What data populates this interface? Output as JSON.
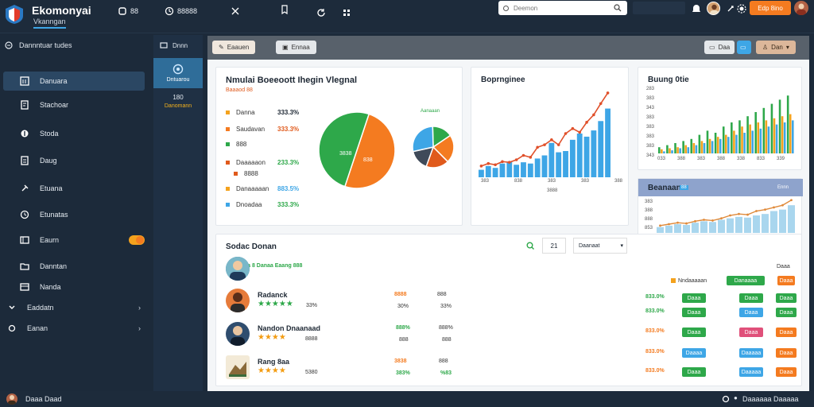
{
  "app": {
    "brand": "Ekomonyai",
    "brand_sub": "Vkanngan",
    "top_nav": [
      "88",
      "888",
      "88888"
    ],
    "search_placeholder": "Deemon",
    "cta_button": "Edp 8ino",
    "colors": {
      "accent": "#f47b20",
      "blue": "#3ea6e6",
      "green": "#2ea84a",
      "sidebar": "#1c2a3a"
    }
  },
  "sidebar": {
    "header": "Dannntuar tudes",
    "items": [
      {
        "label": "Danuara",
        "icon": "dashboard-icon",
        "active": true
      },
      {
        "label": "Stachoar",
        "icon": "document-icon"
      },
      {
        "label": "Stoda",
        "icon": "tag-icon"
      },
      {
        "label": "Daug",
        "icon": "file-icon"
      },
      {
        "label": "Etuana",
        "icon": "pin-icon"
      },
      {
        "label": "Etunatas",
        "icon": "clock-icon"
      },
      {
        "label": "Eaurn",
        "icon": "flag-icon",
        "toggle": true
      },
      {
        "label": "Danntan",
        "icon": "folder-icon"
      },
      {
        "label": "Nanda",
        "icon": "archive-icon"
      },
      {
        "label": "Eaddatn",
        "icon": "chevron-down-icon",
        "expandable": true
      },
      {
        "label": "Eanan",
        "icon": "gear-icon",
        "expandable": true
      }
    ]
  },
  "subcol": {
    "header": "Dnnn",
    "active_label": "Dntuarou",
    "count": "180",
    "count_sub": "Danomann"
  },
  "toolbar": {
    "btn1": "Eaauen",
    "btn2": "Ennaa",
    "right1": "Daa",
    "right2": "Dan"
  },
  "market_card": {
    "title": "Nmulai Boeeoott Ihegin Vlegnal",
    "subtitle": "Baaaod 88",
    "rows": [
      {
        "label": "Danna",
        "pct": "333.3%",
        "color": "#f4a21d",
        "pct_color": "#1d2733"
      },
      {
        "label": "Saudavan",
        "pct": "333.3%",
        "color": "#f47b20",
        "pct_color": "#e05a1c"
      },
      {
        "label": "888",
        "pct": "",
        "color": "#2ea84a",
        "pct_color": "#1d2733"
      },
      {
        "label": "Daaaaaon",
        "pct": "233.3%",
        "color": "#e05a1c",
        "pct_color": "#2ea84a"
      },
      {
        "label": "8888",
        "pct": "",
        "color": "#e05a1c",
        "pct_color": "#1d2733"
      },
      {
        "label": "Danaaaaan",
        "pct": "883.5%",
        "color": "#f4a21d",
        "pct_color": "#3ea6e6"
      },
      {
        "label": "Dnoadaa",
        "pct": "333.3%",
        "color": "#3ea6e6",
        "pct_color": "#2ea84a"
      }
    ],
    "pie_main_labels": [
      "3838",
      "838"
    ],
    "pie_small_label": "Aanaaan"
  },
  "chart_card1": {
    "title": "Boprnginee",
    "xticks": [
      "383",
      "838",
      "383",
      "383",
      "388"
    ],
    "xlabel": "3888"
  },
  "chart_card2": {
    "title": "Buung 0tie",
    "yticks": [
      "283",
      "383",
      "343",
      "383",
      "383",
      "383",
      "383",
      "343"
    ],
    "xticks": [
      "033",
      "388",
      "383",
      "388",
      "338",
      "833",
      "339"
    ]
  },
  "chart_card3": {
    "title": "Beanaans",
    "badge": "88",
    "right_label": "Ennn",
    "yticks": [
      "383",
      "388",
      "888",
      "853"
    ],
    "xticks": [
      "138",
      "388",
      "389",
      "383",
      "588",
      "383"
    ]
  },
  "chart_data": [
    {
      "type": "pie",
      "title": "",
      "labels": [
        "orange",
        "green"
      ],
      "values": [
        50,
        50
      ],
      "colors": [
        "#f47b20",
        "#2ea84a"
      ]
    },
    {
      "type": "pie",
      "title": "",
      "values": [
        16,
        22,
        18,
        16,
        28
      ],
      "colors": [
        "#2ea84a",
        "#f47b20",
        "#e05a1c",
        "#3f4a59",
        "#3ea6e6"
      ]
    },
    {
      "type": "bar+line",
      "title": "Boprnginee",
      "bars": [
        12,
        18,
        15,
        22,
        25,
        20,
        24,
        22,
        30,
        35,
        55,
        40,
        42,
        60,
        70,
        65,
        75,
        90,
        110
      ],
      "line": [
        18,
        22,
        20,
        25,
        24,
        28,
        35,
        32,
        48,
        52,
        60,
        52,
        70,
        78,
        72,
        88,
        100,
        118,
        135
      ]
    },
    {
      "type": "bar",
      "title": "Buung 0tie",
      "series": [
        {
          "values": [
            6,
            8,
            10,
            12,
            14,
            18,
            22,
            20,
            26,
            30,
            32,
            36,
            40,
            44,
            48,
            52,
            56
          ],
          "color": "#2ea84a"
        },
        {
          "values": [
            4,
            5,
            6,
            8,
            10,
            12,
            14,
            16,
            18,
            22,
            26,
            28,
            30,
            32,
            34,
            36,
            38
          ],
          "color": "#f4a21d"
        },
        {
          "values": [
            2,
            3,
            5,
            6,
            8,
            10,
            12,
            14,
            16,
            18,
            20,
            22,
            24,
            26,
            28,
            30,
            32
          ],
          "color": "#3ea6e6"
        }
      ]
    },
    {
      "type": "bar+line",
      "title": "Beanaans",
      "bars": [
        8,
        10,
        12,
        11,
        14,
        16,
        15,
        18,
        20,
        22,
        21,
        24,
        26,
        30,
        32,
        38
      ],
      "line": [
        10,
        12,
        14,
        13,
        16,
        18,
        17,
        20,
        24,
        26,
        25,
        30,
        32,
        35,
        38,
        45
      ]
    }
  ],
  "table": {
    "title": "Sodac Donan",
    "filter_label": "21",
    "dropdown": "Daanaat",
    "legend": "Danaa 8 Danaa Eaang 888",
    "right_header": "Daaa",
    "right_pills": [
      {
        "label": "Nndaaaaan",
        "color": "#f4a21d"
      },
      {
        "label": "Danaaaa",
        "color": "#2ea84a"
      },
      {
        "label": "Daaa",
        "color": "#f47b20"
      }
    ],
    "rows": [
      {
        "name": "",
        "stars": "",
        "val": "",
        "c1": "",
        "c2": "",
        "avatar_color": "#3a7a9c"
      },
      {
        "name": "Radanck",
        "stars": "★★★★★",
        "val": "33%",
        "c1": "30%",
        "c2": "33%",
        "c1top": "8888",
        "c2top": "888",
        "avatar_color": "#d4673a"
      },
      {
        "name": "Nandon Dnaanaad",
        "stars": "★★★★",
        "val": "8888",
        "c1": "888",
        "c2": "888",
        "c1top": "888%",
        "c2top": "888%",
        "avatar_color": "#1f3a5a"
      },
      {
        "name": "Rang 8aa",
        "stars": "★★★★",
        "val": "5380",
        "c1": "383%",
        "c2": "%83",
        "c1top": "3838",
        "c2top": "888",
        "avatar_color": "#c2853f"
      }
    ],
    "right_rows": [
      {
        "pct": "833.0%",
        "pct_color": "#2ea84a",
        "p1": "Daaa",
        "p1c": "#2ea84a",
        "p2": "Daaa",
        "p2c": "#2ea84a",
        "p3": "Daaa",
        "p3c": "#2ea84a"
      },
      {
        "pct": "833.0%",
        "pct_color": "#2ea84a",
        "p1": "Daaa",
        "p1c": "#2ea84a",
        "p2": "Daaa",
        "p2c": "#3ea6e6",
        "p3": "Daaa",
        "p3c": "#2ea84a"
      },
      {
        "pct": "833.0%",
        "pct_color": "#f47b20",
        "p1": "Daaa",
        "p1c": "#2ea84a",
        "p2": "Daaa",
        "p2c": "#e0507a",
        "p3": "Daaa",
        "p3c": "#f47b20"
      },
      {
        "pct": "833.0%",
        "pct_color": "#f47b20",
        "p1": "Daaaa",
        "p1c": "#3ea6e6",
        "p2": "Daaaaa",
        "p2c": "#3ea6e6",
        "p3": "Daaa",
        "p3c": "#f47b20"
      },
      {
        "pct": "833.0%",
        "pct_color": "#f47b20",
        "p1": "Daaa",
        "p1c": "#2ea84a",
        "p2": "Daaaaa",
        "p2c": "#3ea6e6",
        "p3": "Daaa",
        "p3c": "#f47b20"
      }
    ]
  },
  "footer": {
    "user": "Daaa Daad",
    "right": "Daaaaaa Daaaaa"
  }
}
